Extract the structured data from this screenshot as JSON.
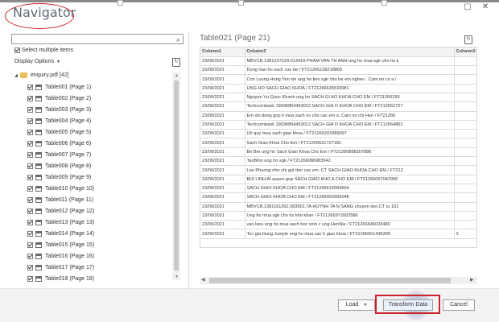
{
  "window": {
    "title": "Navigator",
    "min_glyph": "–",
    "max_glyph": "▢",
    "close_glyph": "✕"
  },
  "left": {
    "search_placeholder": "",
    "select_multiple_label": "Select multiple items",
    "display_options_label": "Display Options",
    "root": {
      "label": "enquiry.pdf [42]"
    },
    "items": [
      "Table001 (Page 1)",
      "Table002 (Page 2)",
      "Table003 (Page 3)",
      "Table004 (Page 4)",
      "Table005 (Page 5)",
      "Table006 (Page 6)",
      "Table007 (Page 7)",
      "Table008 (Page 8)",
      "Table009 (Page 9)",
      "Table010 (Page 10)",
      "Table011 (Page 11)",
      "Table012 (Page 12)",
      "Table013 (Page 13)",
      "Table014 (Page 14)",
      "Table015 (Page 15)",
      "Table016 (Page 16)",
      "Table017 (Page 17)",
      "Table018 (Page 18)"
    ]
  },
  "preview": {
    "title": "Table021 (Page 21)",
    "columns": [
      "Column1",
      "Column2",
      "Column3"
    ],
    "rows": [
      [
        "23/09/2021",
        "MBVCB.1381237229.013419.PHAM VAN TH ANH ung ho mua sgk cho hs k",
        ""
      ],
      [
        "23/09/2021",
        "Dung Van ho sach cac be / FT21266138218865",
        ""
      ],
      [
        "23/09/2021",
        "Con Luong Hong Yen xin ung ho tien sgk cho tre em ngheo . Cam on co a /",
        ""
      ],
      [
        "23/09/2021",
        "UNG HO SACH GIAO KHOA / FT21266635533081",
        ""
      ],
      [
        "23/09/2021",
        "Nguyen Vu Quoc Khanh ung ho SACH GI AO KHOA CHO EM / FT21266295",
        ""
      ],
      [
        "23/09/2021",
        "Techcombank 19036854453012 SACH GIA O KHOA CHO EM / FT212662727",
        ""
      ],
      [
        "23/09/2021",
        "Em xin dong gop it mua sach vo cho cac em a. Cam on chi Hen / FT21266",
        ""
      ],
      [
        "23/09/2021",
        "Techcombank 19036854453012 SACH GIA O KHOA CHO EM / FT212664862",
        ""
      ],
      [
        "23/09/2021",
        "Uh quy mua sach giao khoa / FT21266203389097",
        ""
      ],
      [
        "23/09/2021",
        "Sach Giao Khoa Cho Em / FT21266531727181",
        ""
      ],
      [
        "23/09/2021",
        "Be Ber ung ho Sach Giao Khoa Cho Em / FT21266898207886",
        ""
      ],
      [
        "23/09/2021",
        "TanBiho ung ho sgk / FT21266086983942",
        ""
      ],
      [
        "23/09/2021",
        "Lan Phuong nho chi gui den cac em. CT SACH GIAO KHOA CHO EM / FT212",
        ""
      ],
      [
        "23/09/2021",
        "BUI LINH AI quyen gop SACH GIAO KHO A CHO EM / FT21266057042906",
        ""
      ],
      [
        "23/09/2021",
        "SACH GIAO KHOA CHO EM / FT21266615584604",
        ""
      ],
      [
        "23/09/2021",
        "SACH GIAO KHOA CHO EM / FT21266002992048",
        ""
      ],
      [
        "23/09/2021",
        "MBVCB.1381161362.083901.TA HUYNH TA N SANG chuyen tien.CT tu 101",
        ""
      ],
      [
        "23/09/2021",
        "Ung ho mua sgk cho hs kho khan / FT21266972002586",
        ""
      ],
      [
        "23/09/2021",
        "van kieu ung ho mua sach hoc sinh c ung HenNie / FT21266645033480",
        ""
      ],
      [
        "23/09/2021",
        "Toc gia Hung Justyle ung ho mua sac h giao khoa / FT21266661435390",
        "2"
      ]
    ]
  },
  "footer": {
    "load_label": "Load",
    "transform_label": "Transform Data",
    "cancel_label": "Cancel"
  },
  "colors": {
    "highlight": "#c8242b",
    "folder": "#e8c15c"
  }
}
